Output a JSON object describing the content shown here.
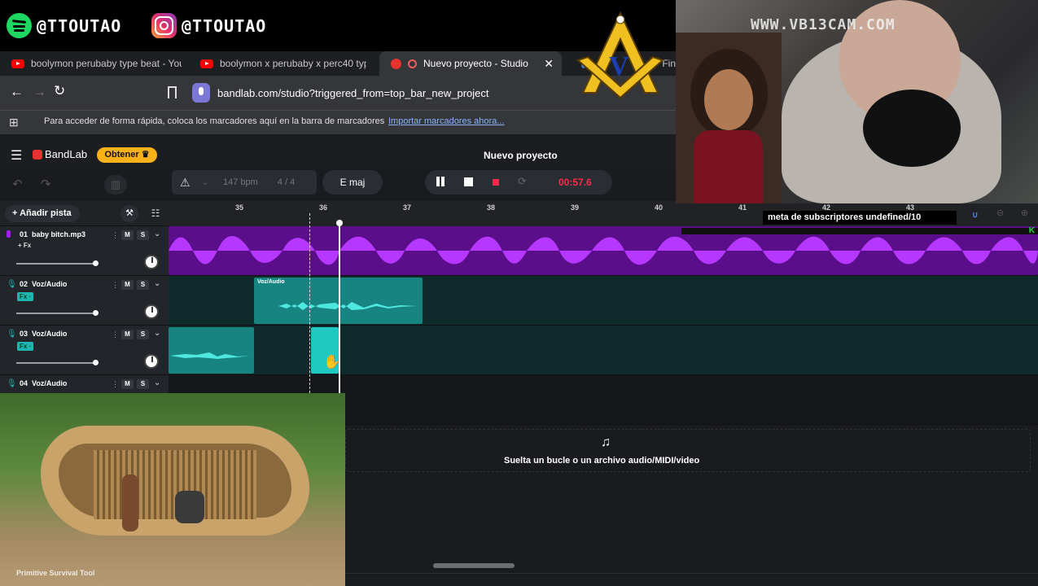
{
  "social": {
    "spotify_handle": "@TTOUTAO",
    "instagram_handle": "@TTOUTAO"
  },
  "browser": {
    "tabs": [
      {
        "label": "boolymon perubaby type beat - YouT"
      },
      {
        "label": "boolymon x perubaby x perc40 type"
      },
      {
        "label": "Nuevo proyecto - Studio"
      },
      {
        "label": "Fin"
      }
    ],
    "url": "bandlab.com/studio?triggered_from=top_bar_new_project",
    "bookmarks_text": "Para acceder de forma rápida, coloca los marcadores aquí en la barra de marcadores",
    "bookmarks_link": "Importar marcadores ahora..."
  },
  "bandlab": {
    "brand": "BandLab",
    "get_button": "Obtener",
    "project_title": "Nuevo proyecto",
    "bpm_value": "147",
    "bpm_unit": "bpm",
    "time_signature": "4 / 4",
    "key": "E maj",
    "time": "00:57.6",
    "add_track": "Añadir pista",
    "ruler_ticks": [
      "35",
      "36",
      "37",
      "38",
      "39",
      "40",
      "41",
      "42",
      "43"
    ],
    "tracks": [
      {
        "number": "01",
        "name": "baby bitch.mp3",
        "fx": "+ Fx"
      },
      {
        "number": "02",
        "name": "Voz/Audio",
        "fx": "Fx"
      },
      {
        "number": "03",
        "name": "Voz/Audio",
        "fx": "Fx"
      },
      {
        "number": "04",
        "name": "Voz/Audio",
        "fx": ""
      }
    ],
    "clip_label": "Voz/Audio",
    "drop_text": "Suelta un bucle o un archivo audio/MIDI/video",
    "mute_label": "M",
    "solo_label": "S"
  },
  "webcam": {
    "watermark": "WWW.VB13CAM.COM",
    "sub_goal": "meta de subscriptores undefined/10"
  },
  "video": {
    "caption": "Primitive Survival Tool"
  },
  "colors": {
    "accent_purple": "#a020f0",
    "accent_teal": "#1fb5b0",
    "record_red": "#ff2b4a",
    "get_yellow": "#f8b118"
  }
}
